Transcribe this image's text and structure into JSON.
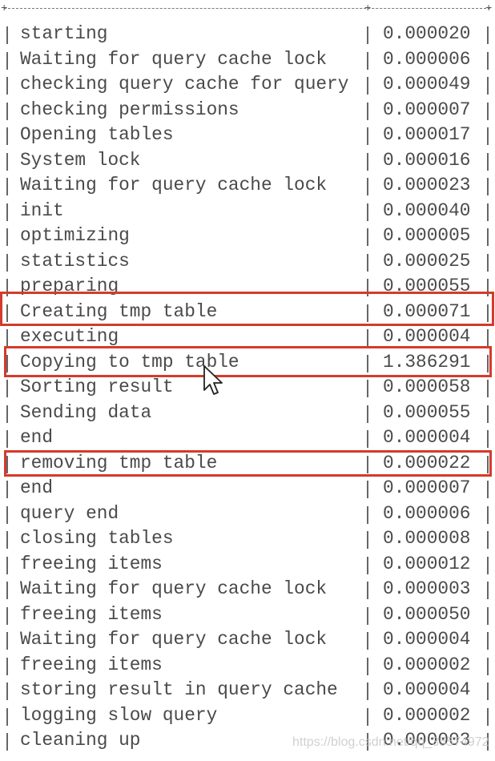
{
  "profile_rows": [
    {
      "state": "starting",
      "duration": "0.000020"
    },
    {
      "state": "Waiting for query cache lock",
      "duration": "0.000006"
    },
    {
      "state": "checking query cache for query",
      "duration": "0.000049"
    },
    {
      "state": "checking permissions",
      "duration": "0.000007"
    },
    {
      "state": "Opening tables",
      "duration": "0.000017"
    },
    {
      "state": "System lock",
      "duration": "0.000016"
    },
    {
      "state": "Waiting for query cache lock",
      "duration": "0.000023"
    },
    {
      "state": "init",
      "duration": "0.000040"
    },
    {
      "state": "optimizing",
      "duration": "0.000005"
    },
    {
      "state": "statistics",
      "duration": "0.000025"
    },
    {
      "state": "preparing",
      "duration": "0.000055"
    },
    {
      "state": "Creating tmp table",
      "duration": "0.000071",
      "highlighted": true
    },
    {
      "state": "executing",
      "duration": "0.000004"
    },
    {
      "state": "Copying to tmp table",
      "duration": "1.386291",
      "highlighted": true
    },
    {
      "state": "Sorting result",
      "duration": "0.000058"
    },
    {
      "state": "Sending data",
      "duration": "0.000055"
    },
    {
      "state": "end",
      "duration": "0.000004"
    },
    {
      "state": "removing tmp table",
      "duration": "0.000022",
      "highlighted": true
    },
    {
      "state": "end",
      "duration": "0.000007"
    },
    {
      "state": "query end",
      "duration": "0.000006"
    },
    {
      "state": "closing tables",
      "duration": "0.000008"
    },
    {
      "state": "freeing items",
      "duration": "0.000012"
    },
    {
      "state": "Waiting for query cache lock",
      "duration": "0.000003"
    },
    {
      "state": "freeing items",
      "duration": "0.000050"
    },
    {
      "state": "Waiting for query cache lock",
      "duration": "0.000004"
    },
    {
      "state": "freeing items",
      "duration": "0.000002"
    },
    {
      "state": "storing result in query cache",
      "duration": "0.000004"
    },
    {
      "state": "logging slow query",
      "duration": "0.000002"
    },
    {
      "state": "cleaning up",
      "duration": "0.000003"
    }
  ],
  "highlight_color": "#d43b2b",
  "cursor_icon": "arrow-pointer",
  "watermark": "https://blog.csdn.net/qq_35574972"
}
